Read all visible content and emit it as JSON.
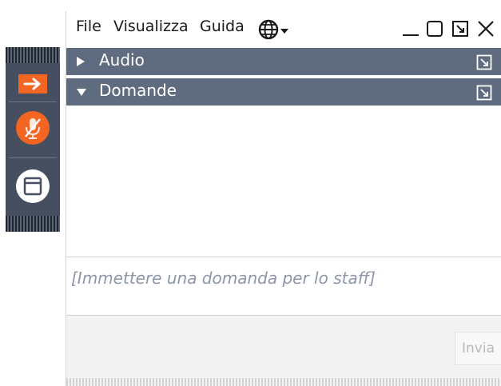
{
  "menu": {
    "file": "File",
    "view": "Visualizza",
    "help": "Guida"
  },
  "icons": {
    "language": "globe-icon",
    "minimize": "minimize-icon",
    "maximize": "maximize-icon",
    "restore": "popout-icon",
    "close": "close-icon",
    "collapsed": "triangle-right-icon",
    "expanded": "triangle-down-icon",
    "share": "arrow-right-icon",
    "mic": "mic-muted-icon",
    "window": "window-icon"
  },
  "sections": {
    "audio": {
      "label": "Audio",
      "expanded": false
    },
    "questions": {
      "label": "Domande",
      "expanded": true
    }
  },
  "question_input": {
    "value": "",
    "placeholder": "[Immettere una domanda per lo staff]"
  },
  "send_button": {
    "label": "Invia"
  },
  "colors": {
    "accent_orange": "#f26522",
    "section_bar": "#5f6b7f",
    "strip": "#454f5f",
    "placeholder": "#8c96a8"
  }
}
